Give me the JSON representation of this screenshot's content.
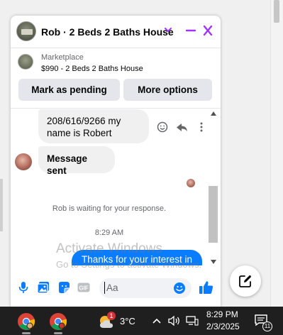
{
  "chat": {
    "title": "Rob · 2 Beds 2 Baths House",
    "marketplace_label": "Marketplace",
    "listing_price_title": "$990 - 2 Beds 2 Baths House",
    "mark_pending_label": "Mark as pending",
    "more_options_label": "More options",
    "messages": [
      "208/616/9266 my name is Robert",
      "Message sent"
    ],
    "status_text": "Rob is waiting for your response.",
    "timestamp": "8:29 AM",
    "outgoing_preview": "Thanks for your interest in",
    "composer_placeholder": "Aa",
    "accent_color": "#a033ff",
    "bubble_color": "#0a7cff"
  },
  "watermark": {
    "line1": "Activate Windows",
    "line2": "Go to Settings to activate Windows."
  },
  "taskbar": {
    "weather_badge": "1",
    "temperature": "3°C",
    "time": "8:29 PM",
    "date": "2/3/2025",
    "notification_count": "11"
  }
}
